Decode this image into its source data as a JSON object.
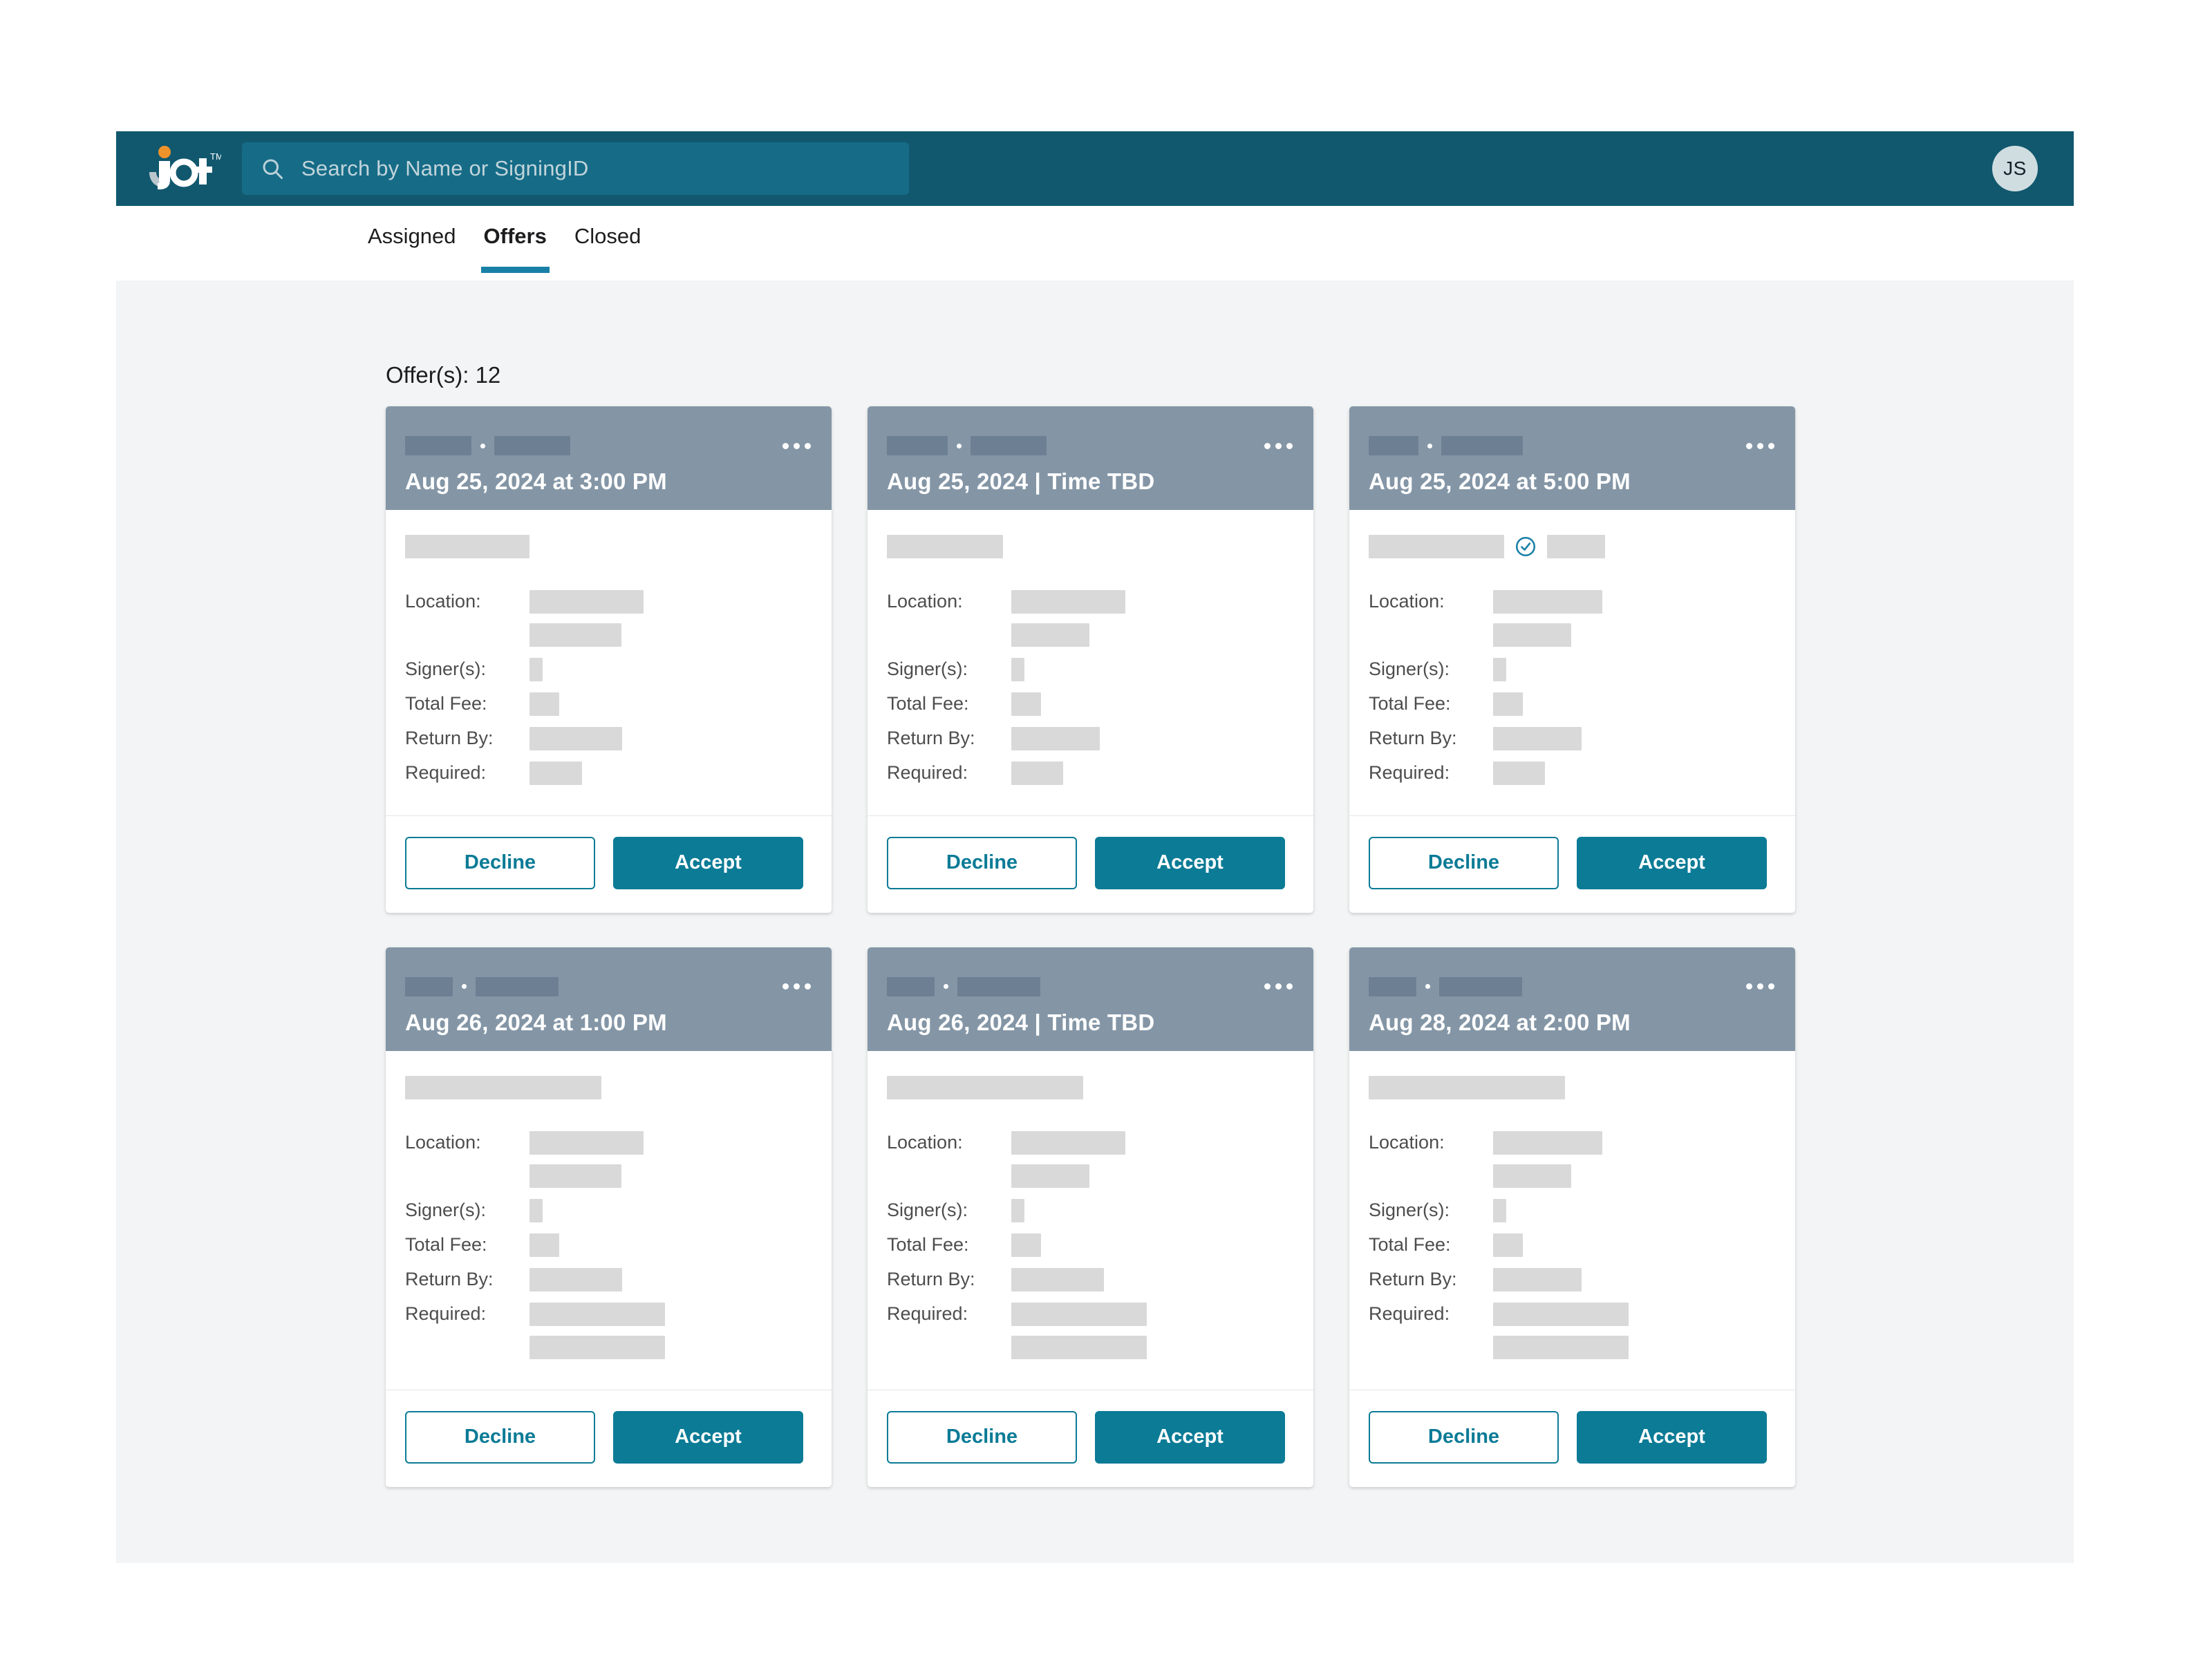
{
  "brand": {
    "logo_text": "jot",
    "logo_tm": "TM",
    "dot_color": "#f0932b",
    "topbar_color": "#11586e",
    "accent_color": "#0b7b96"
  },
  "search": {
    "placeholder": "Search by Name or SigningID",
    "value": "",
    "icon": "search-icon"
  },
  "account": {
    "avatar_initials": "JS"
  },
  "tabs": [
    {
      "label": "Assigned",
      "active": false
    },
    {
      "label": "Offers",
      "active": true
    },
    {
      "label": "Closed",
      "active": false
    }
  ],
  "main": {
    "offers_count_label": "Offer(s): 12"
  },
  "card_labels": {
    "location": "Location:",
    "signers": "Signer(s):",
    "total_fee": "Total Fee:",
    "return_by": "Return By:",
    "required": "Required:",
    "decline": "Decline",
    "accept": "Accept",
    "menu_icon": "kebab-menu-icon",
    "verified_icon": "circle-check-icon"
  },
  "cards": [
    {
      "date": "Aug 25, 2024 at 3:00 PM",
      "has_verified_icon": false,
      "has_extra_required_line": false,
      "head_redactions": [
        96,
        110
      ],
      "title_redaction": 180,
      "values": {
        "location1": 165,
        "location2": 133,
        "signers": 19,
        "total_fee": 43,
        "return_by": 134,
        "required": 76
      }
    },
    {
      "date": "Aug 25, 2024 | Time TBD",
      "has_verified_icon": false,
      "has_extra_required_line": false,
      "head_redactions": [
        88,
        110
      ],
      "title_redaction": 168,
      "values": {
        "location1": 165,
        "location2": 113,
        "signers": 19,
        "total_fee": 43,
        "return_by": 128,
        "required": 75
      }
    },
    {
      "date": "Aug 25, 2024 at 5:00 PM",
      "has_verified_icon": true,
      "has_extra_required_line": false,
      "head_redactions": [
        72,
        118
      ],
      "title_redaction": 196,
      "values": {
        "location1": 158,
        "location2": 113,
        "signers": 19,
        "total_fee": 43,
        "return_by": 128,
        "required": 75
      }
    },
    {
      "date": "Aug 26, 2024 at 1:00 PM",
      "has_verified_icon": false,
      "has_extra_required_line": true,
      "head_redactions": [
        69,
        120
      ],
      "title_redaction": 284,
      "values": {
        "location1": 165,
        "location2": 133,
        "signers": 19,
        "total_fee": 43,
        "return_by": 134,
        "required": 196,
        "required2": 196
      }
    },
    {
      "date": "Aug 26, 2024 | Time TBD",
      "has_verified_icon": false,
      "has_extra_required_line": true,
      "head_redactions": [
        69,
        120
      ],
      "title_redaction": 284,
      "values": {
        "location1": 165,
        "location2": 113,
        "signers": 19,
        "total_fee": 43,
        "return_by": 134,
        "required": 196,
        "required2": 196
      }
    },
    {
      "date": "Aug 28, 2024 at 2:00 PM",
      "has_verified_icon": false,
      "has_extra_required_line": true,
      "head_redactions": [
        69,
        120
      ],
      "title_redaction": 284,
      "values": {
        "location1": 158,
        "location2": 113,
        "signers": 19,
        "total_fee": 43,
        "return_by": 128,
        "required": 196,
        "required2": 196
      }
    }
  ]
}
